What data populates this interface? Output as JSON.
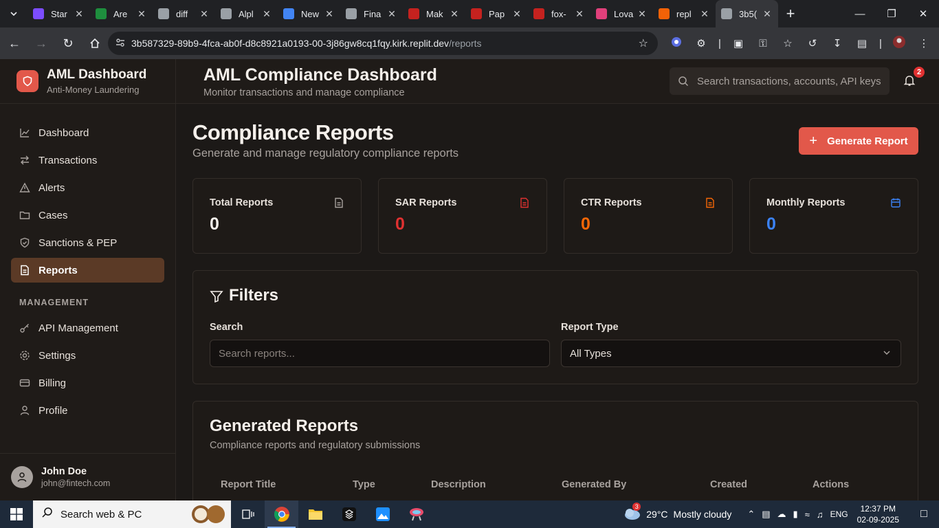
{
  "browser": {
    "tabs": [
      {
        "title": "Star",
        "color": "#7c4dff"
      },
      {
        "title": "Are",
        "color": "#1e8e3e"
      },
      {
        "title": "diff",
        "color": "#9aa0a6"
      },
      {
        "title": "Alpl",
        "color": "#9aa0a6"
      },
      {
        "title": "New",
        "color": "#4285f4"
      },
      {
        "title": "Fina",
        "color": "#9aa0a6"
      },
      {
        "title": "Mak",
        "color": "#c5221f"
      },
      {
        "title": "Pap",
        "color": "#c5221f"
      },
      {
        "title": "fox-",
        "color": "#c5221f"
      },
      {
        "title": "Lova",
        "color": "#e0407b"
      },
      {
        "title": "repl",
        "color": "#f26207"
      },
      {
        "title": "3b5(",
        "color": "#9aa0a6"
      }
    ],
    "url_host": "3b587329-89b9-4fca-ab0f-d8c8921a0193-00-3j86gw8cq1fqy.kirk.replit.dev",
    "url_path": "/reports"
  },
  "sidebar": {
    "brand_title": "AML Dashboard",
    "brand_subtitle": "Anti-Money Laundering",
    "items": [
      {
        "label": "Dashboard"
      },
      {
        "label": "Transactions"
      },
      {
        "label": "Alerts"
      },
      {
        "label": "Cases"
      },
      {
        "label": "Sanctions & PEP"
      },
      {
        "label": "Reports"
      }
    ],
    "section_label": "MANAGEMENT",
    "mgmt_items": [
      {
        "label": "API Management"
      },
      {
        "label": "Settings"
      },
      {
        "label": "Billing"
      },
      {
        "label": "Profile"
      }
    ],
    "user": {
      "name": "John Doe",
      "email": "john@fintech.com"
    }
  },
  "header": {
    "title": "AML Compliance Dashboard",
    "subtitle": "Monitor transactions and manage compliance",
    "search_placeholder": "Search transactions, accounts, API keys",
    "notification_count": "2"
  },
  "page": {
    "title": "Compliance Reports",
    "subtitle": "Generate and manage regulatory compliance reports",
    "generate_button": "Generate Report",
    "stats": [
      {
        "label": "Total Reports",
        "value": "0",
        "color": "#f5f0eb",
        "icon_color": "#a8a29e"
      },
      {
        "label": "SAR Reports",
        "value": "0",
        "color": "#e03131",
        "icon_color": "#e03131"
      },
      {
        "label": "CTR Reports",
        "value": "0",
        "color": "#f76707",
        "icon_color": "#f76707"
      },
      {
        "label": "Monthly Reports",
        "value": "0",
        "color": "#3b82f6",
        "icon_color": "#3b82f6"
      }
    ],
    "filters": {
      "title": "Filters",
      "search_label": "Search",
      "search_placeholder": "Search reports...",
      "type_label": "Report Type",
      "type_value": "All Types"
    },
    "reports": {
      "title": "Generated Reports",
      "subtitle": "Compliance reports and regulatory submissions",
      "columns": [
        "Report Title",
        "Type",
        "Description",
        "Generated By",
        "Created",
        "Actions"
      ]
    }
  },
  "taskbar": {
    "search_text": "Search web & PC",
    "weather_temp": "29°C",
    "weather_text": "Mostly cloudy",
    "weather_badge": "3",
    "lang": "ENG",
    "time": "12:37 PM",
    "date": "02-09-2025"
  }
}
